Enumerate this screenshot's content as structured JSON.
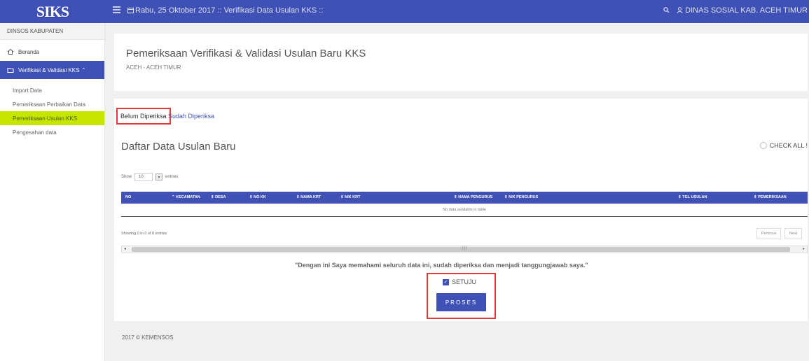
{
  "brand": "SIKS",
  "topbar": {
    "title": "Rabu, 25 Oktober 2017 :: Verifikasi Data Usulan KKS ::",
    "user": "DINAS SOSIAL KAB. ACEH TIMUR"
  },
  "sidebar": {
    "header": "DINSOS KABUPATEN",
    "items": [
      {
        "label": "Beranda",
        "icon": "home-icon"
      },
      {
        "label": "Verifikasi & Validasi KKS"
      }
    ],
    "subitems": [
      {
        "label": "Import Data"
      },
      {
        "label": "Pemeriksaan Perbaikan Data"
      },
      {
        "label": "Pemeriksaan Usulan KKS"
      },
      {
        "label": "Pengesahan data"
      }
    ]
  },
  "page": {
    "title": "Pemeriksaan Verifikasi & Validasi Usulan Baru KKS",
    "subtitle": "ACEH - ACEH TIMUR"
  },
  "tabs": [
    {
      "label": "Belum Diperiksa"
    },
    {
      "label": "Sudah Diperiksa"
    }
  ],
  "list": {
    "title": "Daftar Data Usulan Baru",
    "check_all": "CHECK ALL !",
    "show_label": "Show",
    "show_value": "10",
    "entries_label": "entries",
    "columns": [
      "NO",
      "KECAMATAN",
      "DESA",
      "NO KK",
      "NAMA KRT",
      "NIK KRT",
      "NAMA PENGURUS",
      "NIK PENGURUS",
      "TGL USULAN",
      "PEMERIKSAAN"
    ],
    "empty": "No data available in table",
    "showing": "Showing 0 to 0 of 0 entries",
    "prev": "Previous",
    "next": "Next"
  },
  "statement": "\"Dengan ini Saya memahami seluruh data ini, sudah diperiksa dan menjadi tanggungjawab saya.\"",
  "agree": {
    "label": "SETUJU",
    "checked": true
  },
  "process_button": "PROSES",
  "footer": "2017 © KEMENSOS",
  "colors": {
    "primary": "#3f51b5",
    "highlight": "#c6e600",
    "annotation": "#e23a3a"
  }
}
